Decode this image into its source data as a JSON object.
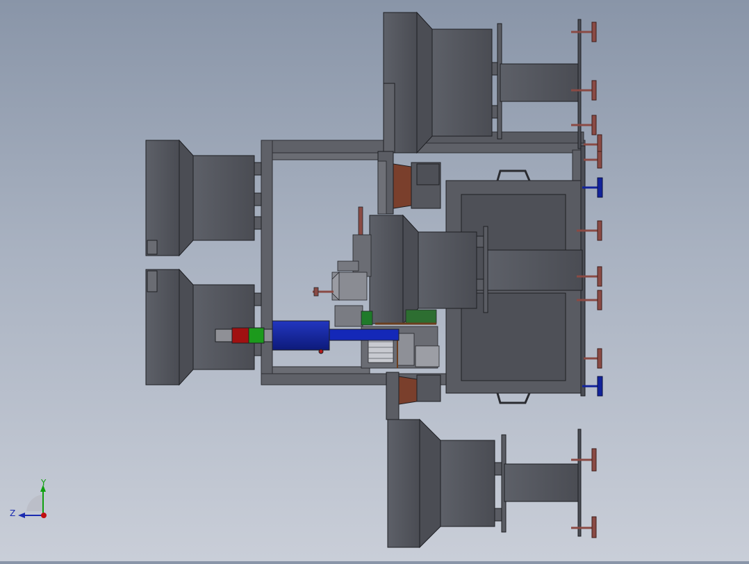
{
  "window": {
    "background_top": "#8995a8",
    "background_bottom": "#c9ced8"
  },
  "model": {
    "body_color": "#55575f",
    "body_dark": "#44464d",
    "frame_color": "#60626a",
    "handle_color": "#8a4a44",
    "accent_blue": "#12239b",
    "accent_red": "#a01111",
    "accent_green": "#1c9a1c",
    "accent_brown": "#6b3e1e"
  },
  "triad": {
    "y_label": "Y",
    "z_label": "Z",
    "y_color": "#10a010",
    "z_color": "#1a2bb0",
    "x_color": "#c01010"
  }
}
